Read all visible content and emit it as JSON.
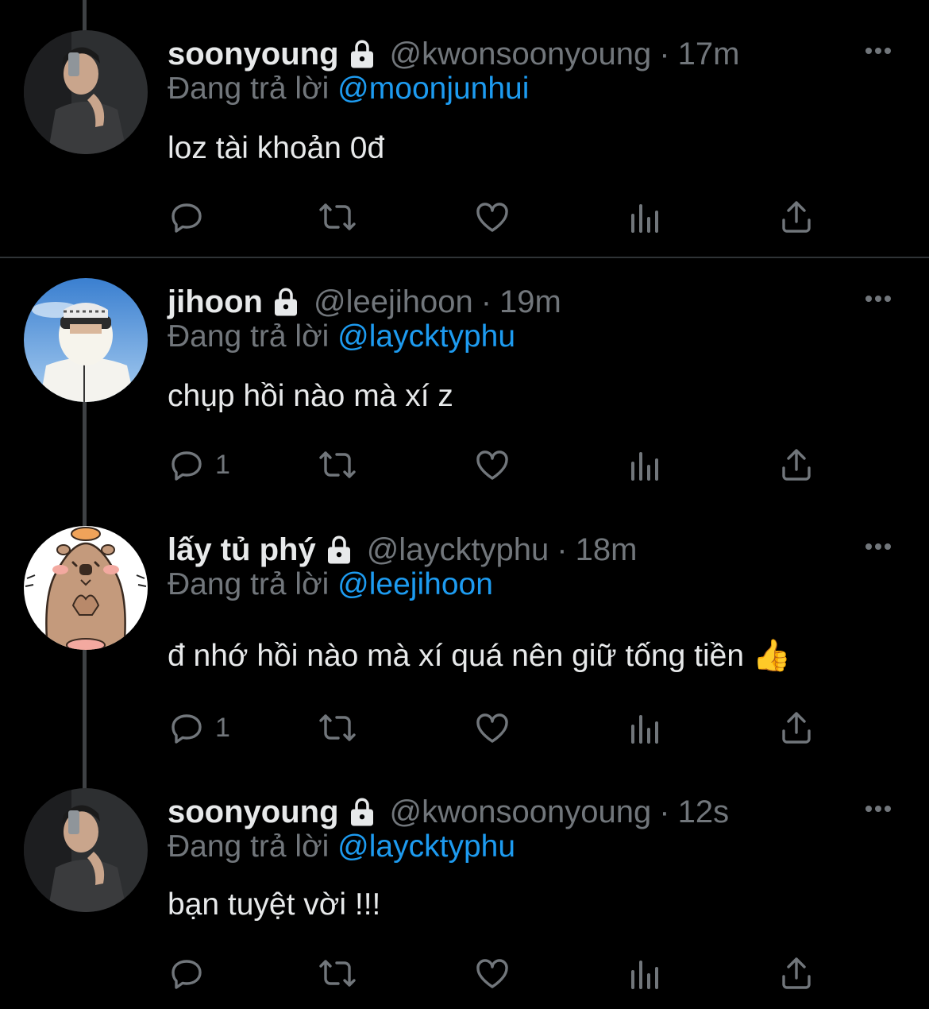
{
  "colors": {
    "background": "#000000",
    "primary_text": "#e7e9ea",
    "secondary_text": "#71767b",
    "mention": "#1d9bf0",
    "thread_line": "#3e4144"
  },
  "reply_prefix": "Đang trả lời",
  "tweets": [
    {
      "display_name": "soonyoung",
      "handle": "@kwonsoonyoung",
      "separator": "·",
      "time": "17m",
      "reply_to": "@moonjunhui",
      "text": "loz tài khoản 0đ",
      "reply_count": "",
      "avatar": "mirror-selfie-avatar"
    },
    {
      "display_name": "jihoon",
      "handle": "@leejihoon",
      "separator": "·",
      "time": "19m",
      "reply_to": "@laycktyphu",
      "text": "chụp hồi nào mà xí z",
      "reply_count": "1",
      "avatar": "masked-face-avatar"
    },
    {
      "display_name": "lấy tủ phý",
      "handle": "@laycktyphu",
      "separator": "·",
      "time": "18m",
      "reply_to": "@leejihoon",
      "text": "đ nhớ hồi nào mà xí quá nên giữ tống tiền 👍",
      "reply_count": "1",
      "avatar": "capybara-avatar"
    },
    {
      "display_name": "soonyoung",
      "handle": "@kwonsoonyoung",
      "separator": "·",
      "time": "12s",
      "reply_to": "@laycktyphu",
      "text": "bạn tuyệt vời !!!",
      "reply_count": "",
      "avatar": "mirror-selfie-avatar"
    }
  ],
  "icons": {
    "reply": "reply-icon",
    "retweet": "retweet-icon",
    "like": "like-icon",
    "views": "views-icon",
    "share": "share-icon",
    "more": "more-icon",
    "lock": "lock-icon"
  }
}
